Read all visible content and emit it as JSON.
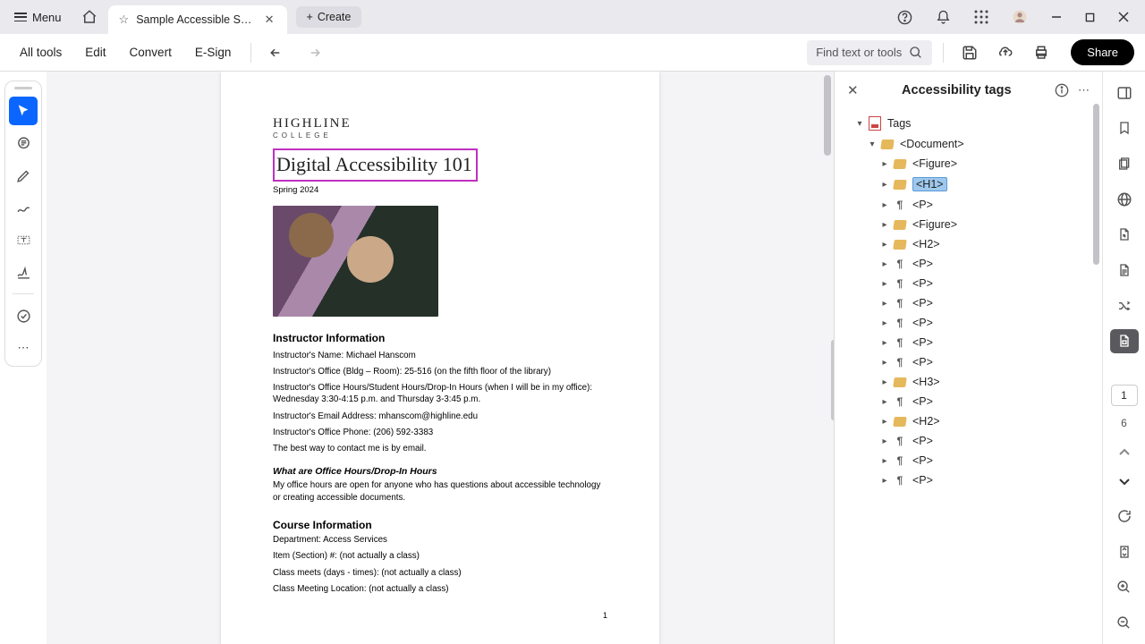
{
  "titlebar": {
    "menu": "Menu",
    "tab_title": "Sample Accessible Sylla...",
    "create": "Create"
  },
  "toolbar": {
    "all_tools": "All tools",
    "edit": "Edit",
    "convert": "Convert",
    "esign": "E-Sign",
    "find_placeholder": "Find text or tools",
    "share": "Share"
  },
  "document": {
    "logo": "HIGHLINE",
    "logo_sub": "COLLEGE",
    "h1": "Digital Accessibility 101",
    "term": "Spring 2024",
    "h2_instructor": "Instructor Information",
    "p_name": "Instructor's Name: Michael Hanscom",
    "p_office": "Instructor's Office (Bldg – Room): 25-516 (on the fifth floor of the library)",
    "p_hours": "Instructor's Office Hours/Student Hours/Drop-In Hours (when I will be in my office): Wednesday 3:30-4:15 p.m. and Thursday 3-3:45 p.m.",
    "p_email": "Instructor's Email Address: mhanscom@highline.edu",
    "p_phone": "Instructor's Office Phone: (206) 592-3383",
    "p_contact": "The best way to contact me is by email.",
    "h3_hours": "What are Office Hours/Drop-In Hours",
    "p_hours_desc": "My office hours are open for anyone who has questions about accessible technology or creating accessible documents.",
    "h2_course": "Course Information",
    "p_dept": "Department: Access Services",
    "p_item": "Item (Section) #: (not actually a class)",
    "p_meets": "Class meets (days - times): (not actually a class)",
    "p_location": "Class Meeting Location: (not actually a class)",
    "page_num": "1"
  },
  "panel": {
    "title": "Accessibility tags",
    "root": "Tags",
    "doc": "<Document>",
    "nodes": [
      {
        "icon": "tag",
        "label": "<Figure>"
      },
      {
        "icon": "tag",
        "label": "<H1>",
        "selected": true
      },
      {
        "icon": "para",
        "label": "<P>"
      },
      {
        "icon": "tag",
        "label": "<Figure>"
      },
      {
        "icon": "tag",
        "label": "<H2>"
      },
      {
        "icon": "para",
        "label": "<P>"
      },
      {
        "icon": "para",
        "label": "<P>"
      },
      {
        "icon": "para",
        "label": "<P>"
      },
      {
        "icon": "para",
        "label": "<P>"
      },
      {
        "icon": "para",
        "label": "<P>"
      },
      {
        "icon": "para",
        "label": "<P>"
      },
      {
        "icon": "tag",
        "label": "<H3>"
      },
      {
        "icon": "para",
        "label": "<P>"
      },
      {
        "icon": "tag",
        "label": "<H2>"
      },
      {
        "icon": "para",
        "label": "<P>"
      },
      {
        "icon": "para",
        "label": "<P>"
      },
      {
        "icon": "para",
        "label": "<P>"
      }
    ]
  },
  "rail": {
    "current_page": "1",
    "total_pages": "6"
  }
}
